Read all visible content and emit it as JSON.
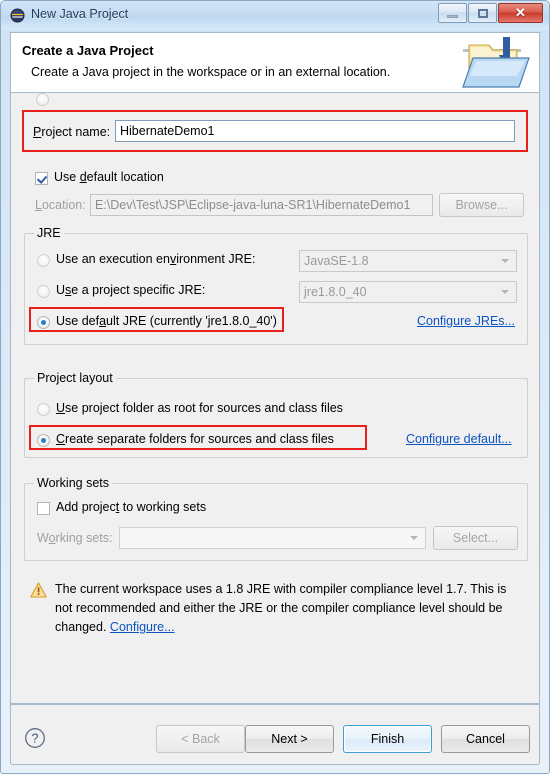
{
  "window": {
    "title": "New Java Project",
    "icon": "eclipse-icon",
    "buttons": {
      "minimize": "minimize-icon",
      "maximize": "maximize-icon",
      "close": "✕"
    }
  },
  "header": {
    "title": "Create a Java Project",
    "description": "Create a Java project in the workspace or in an external location.",
    "icon": "java-project-folder-icon"
  },
  "project": {
    "name_label": "Project name:",
    "name_value": "HibernateDemo1",
    "name_placeholder": "",
    "use_default_location_label": "Use default location",
    "use_default_location_checked": true,
    "location_label": "Location:",
    "location_value": "E:\\Dev\\Test\\JSP\\Eclipse-java-luna-SR1\\HibernateDemo1",
    "browse_label": "Browse..."
  },
  "jre": {
    "group_title": "JRE",
    "options": [
      {
        "label": "Use an execution environment JRE:",
        "selected": false,
        "combo_value": "JavaSE-1.8",
        "combo_enabled": false
      },
      {
        "label": "Use a project specific JRE:",
        "selected": false,
        "combo_value": "jre1.8.0_40",
        "combo_enabled": false
      },
      {
        "label": "Use default JRE (currently 'jre1.8.0_40')",
        "selected": true,
        "combo_value": null,
        "combo_enabled": false
      }
    ],
    "configure_link": "Configure JREs..."
  },
  "layout": {
    "group_title": "Project layout",
    "options": [
      {
        "label": "Use project folder as root for sources and class files",
        "selected": false
      },
      {
        "label": "Create separate folders for sources and class files",
        "selected": true
      }
    ],
    "configure_link": "Configure default..."
  },
  "working_sets": {
    "group_title": "Working sets",
    "add_label": "Add project to working sets",
    "add_checked": false,
    "sets_label": "Working sets:",
    "sets_value": "",
    "select_label": "Select..."
  },
  "warning": {
    "icon": "warning-triangle-icon",
    "text": "The current workspace uses a 1.8 JRE with compiler compliance level 1.7. This is not recommended and either the JRE or the compiler compliance level should be changed. ",
    "link": "Configure..."
  },
  "footer": {
    "help_icon": "help-question-icon",
    "back_label": "< Back",
    "next_label": "Next >",
    "finish_label": "Finish",
    "cancel_label": "Cancel",
    "back_enabled": false,
    "default_button": "Finish"
  },
  "annotations": {
    "highlight_color": "#e8201c",
    "highlighted_regions": [
      "project-name-row",
      "jre-default-option",
      "layout-separate-folders-option"
    ]
  }
}
